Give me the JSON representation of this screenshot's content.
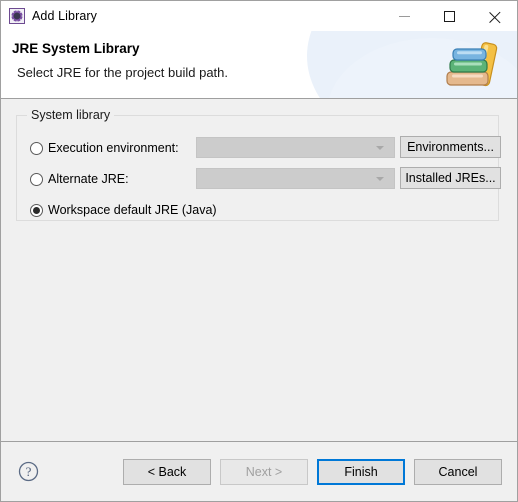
{
  "window": {
    "title": "Add Library",
    "app_icon": "eclipse-gear-icon"
  },
  "window_controls": {
    "minimize_label": "Minimize",
    "maximize_label": "Maximize",
    "close_label": "Close"
  },
  "header": {
    "title": "JRE System Library",
    "subtitle": "Select JRE for the project build path.",
    "banner_icon": "books-stack-icon"
  },
  "group": {
    "legend": "System library",
    "options": [
      {
        "label": "Execution environment:",
        "selected": false,
        "combo_value": "",
        "combo_enabled": false,
        "button_label": "Environments..."
      },
      {
        "label": "Alternate JRE:",
        "selected": false,
        "combo_value": "",
        "combo_enabled": false,
        "button_label": "Installed JREs..."
      },
      {
        "label": "Workspace default JRE (Java)",
        "selected": true
      }
    ]
  },
  "footer": {
    "help_icon": "help-question-icon",
    "buttons": [
      {
        "label": "< Back",
        "state": "enabled"
      },
      {
        "label": "Next >",
        "state": "disabled"
      },
      {
        "label": "Finish",
        "state": "default"
      },
      {
        "label": "Cancel",
        "state": "enabled"
      }
    ]
  },
  "colors": {
    "accent": "#0078d7",
    "window_bg": "#f0f0f0",
    "header_bg": "#ffffff",
    "border": "#9f9f9f"
  }
}
